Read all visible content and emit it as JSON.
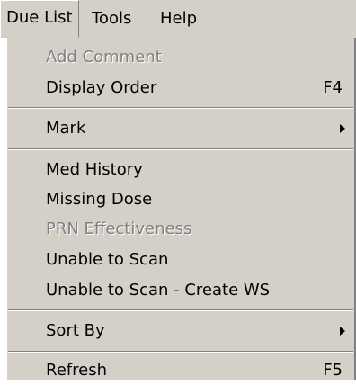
{
  "menubar": {
    "items": [
      {
        "label": "Due List"
      },
      {
        "label": "Tools"
      },
      {
        "label": "Help"
      }
    ]
  },
  "menu": {
    "add_comment": {
      "label": "Add Comment",
      "enabled": false
    },
    "display_order": {
      "label": "Display Order",
      "shortcut": "F4",
      "enabled": true
    },
    "mark": {
      "label": "Mark",
      "submenu_icon": "submenu-arrow-icon",
      "enabled": true
    },
    "med_history": {
      "label": "Med History",
      "enabled": true
    },
    "missing_dose": {
      "label": "Missing Dose",
      "enabled": true
    },
    "prn_effectiveness": {
      "label": "PRN Effectiveness",
      "enabled": false
    },
    "unable_to_scan": {
      "label": "Unable to Scan",
      "enabled": true
    },
    "unable_to_scan_create_ws": {
      "label": "Unable to Scan - Create WS",
      "enabled": true
    },
    "sort_by": {
      "label": "Sort By",
      "submenu_icon": "submenu-arrow-icon",
      "enabled": true
    },
    "refresh": {
      "label": "Refresh",
      "shortcut": "F5",
      "enabled": true
    }
  },
  "colors": {
    "menu_background": "#d4d0c8",
    "disabled_text": "#808080",
    "text": "#000000"
  }
}
